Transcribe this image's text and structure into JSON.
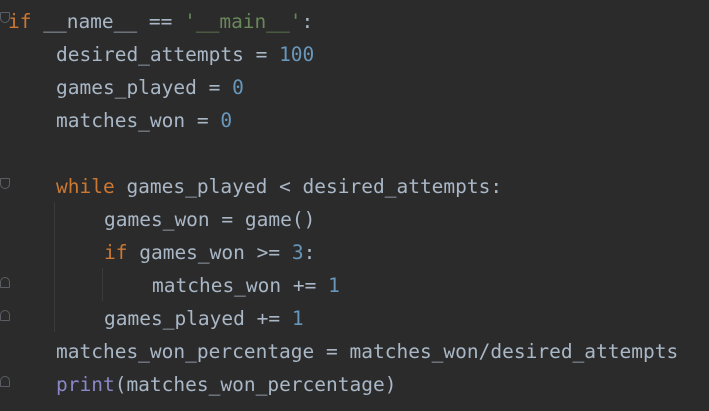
{
  "code": {
    "line1": {
      "kw_if": "if",
      "name": " __name__ == ",
      "str_main": "'__main__'",
      "colon": ":"
    },
    "line2": {
      "text": "desired_attempts = ",
      "num": "100"
    },
    "line3": {
      "text": "games_played = ",
      "num": "0"
    },
    "line4": {
      "text": "matches_won = ",
      "num": "0"
    },
    "line6": {
      "kw_while": "while",
      "text": " games_played < desired_attempts:"
    },
    "line7": {
      "text": "games_won = game()"
    },
    "line8": {
      "kw_if": "if",
      "text": " games_won >= ",
      "num": "3",
      "colon": ":"
    },
    "line9": {
      "text": "matches_won += ",
      "num": "1"
    },
    "line10": {
      "text": "games_played += ",
      "num": "1"
    },
    "line11": {
      "text": "matches_won_percentage = matches_won/desired_attempts"
    },
    "line12": {
      "builtin_print": "print",
      "text": "(matches_won_percentage)"
    }
  },
  "colors": {
    "background": "#2b2b2b",
    "keyword": "#cc7832",
    "string": "#6a8759",
    "number": "#6897bb",
    "builtin": "#8888c6",
    "text": "#a9b7c6"
  }
}
